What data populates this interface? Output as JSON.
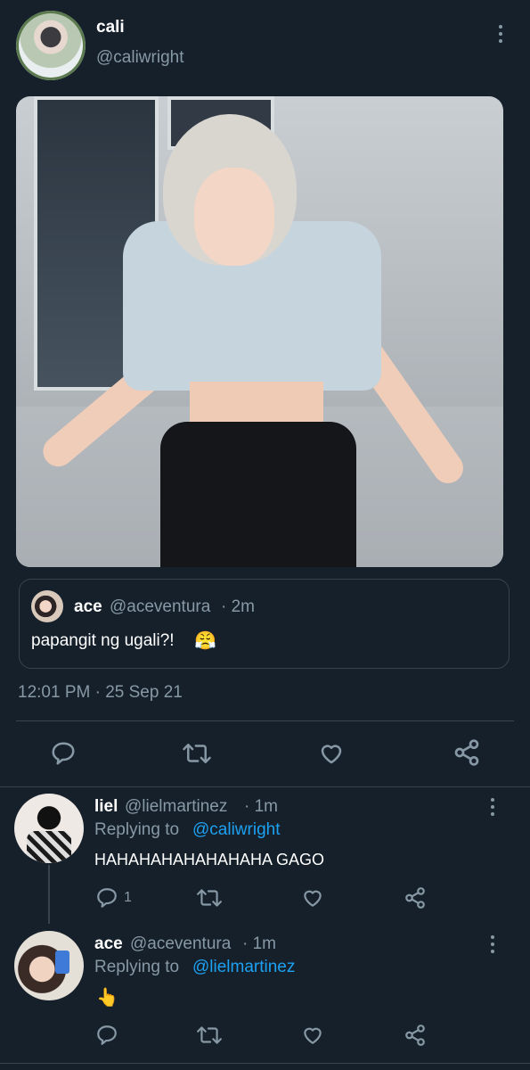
{
  "main_tweet": {
    "author_name": "cali",
    "author_handle": "@caliwright",
    "quoted": {
      "name": "ace",
      "handle": "@aceventura",
      "time": "· 2m",
      "text": "papangit ng ugali?!",
      "emoji": "😤"
    },
    "timestamp": "12:01 PM · 25 Sep 21"
  },
  "replies": [
    {
      "name": "liel",
      "handle": "@lielmartinez",
      "time": "· 1m",
      "replying_prefix": "Replying to",
      "replying_to": "@caliwright",
      "text": "HAHAHAHAHAHAHAHA GAGO",
      "reply_count": "1"
    },
    {
      "name": "ace",
      "handle": "@aceventura",
      "time": "· 1m",
      "replying_prefix": "Replying to",
      "replying_to": "@lielmartinez",
      "text": "👆"
    }
  ],
  "icons": [
    "reply-icon",
    "retweet-icon",
    "like-icon",
    "share-icon",
    "more-icon"
  ],
  "colors": {
    "background": "#15202b",
    "link": "#1da1f2",
    "muted": "#8899a6",
    "border": "#38444d"
  }
}
